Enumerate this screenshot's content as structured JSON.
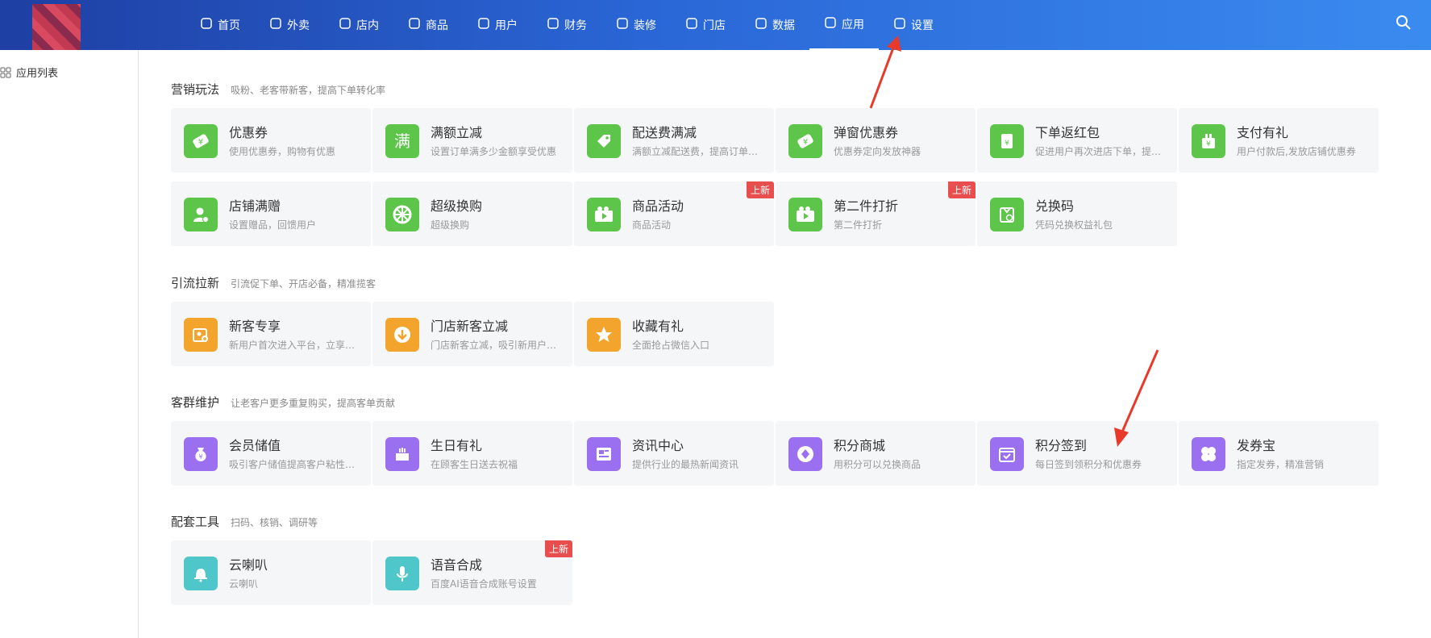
{
  "nav": {
    "items": [
      {
        "label": "首页",
        "icon": "home-icon"
      },
      {
        "label": "外卖",
        "icon": "scooter-icon"
      },
      {
        "label": "店内",
        "icon": "note-icon"
      },
      {
        "label": "商品",
        "icon": "bag-icon"
      },
      {
        "label": "用户",
        "icon": "user-icon"
      },
      {
        "label": "财务",
        "icon": "money-bag-icon"
      },
      {
        "label": "装修",
        "icon": "store-icon"
      },
      {
        "label": "门店",
        "icon": "shop-icon"
      },
      {
        "label": "数据",
        "icon": "chart-icon"
      },
      {
        "label": "应用",
        "icon": "apps-icon",
        "active": true
      },
      {
        "label": "设置",
        "icon": "gear-icon"
      }
    ]
  },
  "sidebar": {
    "item": "应用列表"
  },
  "sections": [
    {
      "title": "营销玩法",
      "subtitle": "吸粉、老客带新客，提高下单转化率",
      "cards": [
        {
          "title": "优惠券",
          "sub": "使用优惠券，购物有优惠",
          "color": "#5cc54a",
          "icon": "coupon-icon"
        },
        {
          "title": "满额立减",
          "sub": "设置订单满多少金额享受优惠",
          "color": "#5cc54a",
          "icon": "man-char-icon"
        },
        {
          "title": "配送费满减",
          "sub": "满额立减配送费，提高订单…",
          "color": "#5cc54a",
          "icon": "tag-icon"
        },
        {
          "title": "弹窗优惠券",
          "sub": "优惠券定向发放神器",
          "color": "#5cc54a",
          "icon": "coupon-icon"
        },
        {
          "title": "下单返红包",
          "sub": "促进用户再次进店下单，提…",
          "color": "#5cc54a",
          "icon": "red-packet-icon"
        },
        {
          "title": "支付有礼",
          "sub": "用户付款后,发放店铺优惠券",
          "color": "#5cc54a",
          "icon": "gift-icon"
        },
        {
          "title": "店铺满赠",
          "sub": "设置赠品，回馈用户",
          "color": "#5cc54a",
          "icon": "user-add-icon"
        },
        {
          "title": "超级换购",
          "sub": "超级换购",
          "color": "#5cc54a",
          "icon": "wheel-icon"
        },
        {
          "title": "商品活动",
          "sub": "商品活动",
          "color": "#5cc54a",
          "icon": "video-icon",
          "badge": "上新"
        },
        {
          "title": "第二件打折",
          "sub": "第二件打折",
          "color": "#5cc54a",
          "icon": "video-icon",
          "badge": "上新"
        },
        {
          "title": "兑换码",
          "sub": "凭码兑换权益礼包",
          "color": "#5cc54a",
          "icon": "redeem-icon"
        }
      ]
    },
    {
      "title": "引流拉新",
      "subtitle": "引流促下单、开店必备，精准揽客",
      "cards": [
        {
          "title": "新客专享",
          "sub": "新用户首次进入平台，立享…",
          "color": "#f3a42c",
          "icon": "new-user-icon"
        },
        {
          "title": "门店新客立减",
          "sub": "门店新客立减，吸引新用户…",
          "color": "#f3a42c",
          "icon": "download-icon"
        },
        {
          "title": "收藏有礼",
          "sub": "全面抢占微信入口",
          "color": "#f3a42c",
          "icon": "star-icon"
        }
      ]
    },
    {
      "title": "客群维护",
      "subtitle": "让老客户更多重复购买，提高客单贡献",
      "cards": [
        {
          "title": "会员储值",
          "sub": "吸引客户储值提高客户粘性…",
          "color": "#9a6ff0",
          "icon": "money-bag-icon"
        },
        {
          "title": "生日有礼",
          "sub": "在顾客生日送去祝福",
          "color": "#9a6ff0",
          "icon": "cake-icon"
        },
        {
          "title": "资讯中心",
          "sub": "提供行业的最热新闻资讯",
          "color": "#9a6ff0",
          "icon": "news-icon"
        },
        {
          "title": "积分商城",
          "sub": "用积分可以兑换商品",
          "color": "#9a6ff0",
          "icon": "diamond-icon"
        },
        {
          "title": "积分签到",
          "sub": "每日签到领积分和优惠券",
          "color": "#9a6ff0",
          "icon": "calendar-check-icon"
        },
        {
          "title": "发券宝",
          "sub": "指定发券，精准营销",
          "color": "#9a6ff0",
          "icon": "clover-icon"
        }
      ]
    },
    {
      "title": "配套工具",
      "subtitle": "扫码、核销、调研等",
      "cards": [
        {
          "title": "云喇叭",
          "sub": "云喇叭",
          "color": "#4fc6c9",
          "icon": "bell-icon"
        },
        {
          "title": "语音合成",
          "sub": "百度AI语音合成账号设置",
          "color": "#4fc6c9",
          "icon": "mic-icon",
          "badge": "上新"
        }
      ]
    }
  ]
}
